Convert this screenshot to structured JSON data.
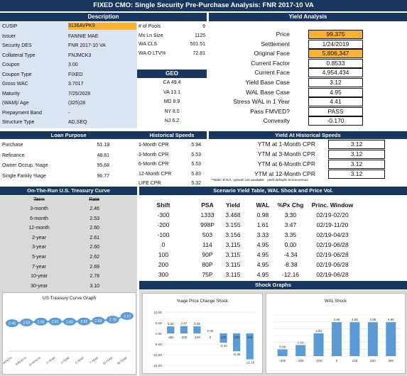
{
  "title": "FIXED CMO: Single Security Pre-Purchase Analysis: FNR 2017-10 VA",
  "description": {
    "header": "Description",
    "left": [
      {
        "label": "CUSIP",
        "value": "3136AVPK9",
        "highlight": true
      },
      {
        "label": "Issuer",
        "value": "FANNIE MAE"
      },
      {
        "label": "Security DES",
        "value": "FNR 2017-10 VA"
      },
      {
        "label": "Collateral Type",
        "value": "FNJMCK3"
      },
      {
        "label": "Coupon",
        "value": "3.00"
      },
      {
        "label": "Coupon Type",
        "value": "FIXED"
      },
      {
        "label": "Gross WAC",
        "value": "3.7017"
      },
      {
        "label": "Maturity",
        "value": "7/25/2028"
      },
      {
        "label": "(WAM)/ Age",
        "value": "(325)28"
      },
      {
        "label": "Prepayment Band",
        "value": "-"
      },
      {
        "label": "Structure Type",
        "value": "AD,SEQ"
      }
    ],
    "right": [
      {
        "label": "# of Pools",
        "value": "9"
      },
      {
        "label": "Mx Ln Size",
        "value": "1125"
      },
      {
        "label": "WA CLS",
        "value": "501.51"
      },
      {
        "label": "WA O LTV%",
        "value": "72.81"
      }
    ]
  },
  "geo": {
    "header": "GEO",
    "items": [
      "CA 49.4",
      "VA 13.1",
      "MD 8.9",
      "NY 8.0",
      "NJ 6.2"
    ]
  },
  "yield_analysis": {
    "header": "Yield Analysis",
    "rows": [
      {
        "label": "Price",
        "value": "99.375",
        "highlight": true
      },
      {
        "label": "Settlement",
        "value": "1/24/2019"
      },
      {
        "label": "Original Face",
        "value": "5,806,347",
        "highlight": true
      },
      {
        "label": "Current Factor",
        "value": "0.8533"
      },
      {
        "label": "Current Face",
        "value": "4,954,434"
      },
      {
        "label": "Yield Base Case",
        "value": "3.12"
      },
      {
        "label": "WAL Base Case",
        "value": "4.95"
      },
      {
        "label": "Stress WAL in 1 Year",
        "value": "4.41"
      },
      {
        "label": "Pass FMVED?",
        "value": "PASS"
      },
      {
        "label": "Convexity",
        "value": "-0.170"
      }
    ]
  },
  "loan_purpose": {
    "header": "Loan Purpose",
    "rows": [
      {
        "label": "Purchase",
        "value": "51.19"
      },
      {
        "label": "Refinance",
        "value": "48.81"
      },
      {
        "label": "Owner Occup. %age",
        "value": "95.68"
      },
      {
        "label": "Single Family %age",
        "value": "96.77"
      }
    ]
  },
  "historical_speeds": {
    "header": "Historical Speeds",
    "rows": [
      {
        "label": "1-Month CPR",
        "value": "5.94"
      },
      {
        "label": "3-Month CPR",
        "value": "5.53"
      },
      {
        "label": "6-Month CPR",
        "value": "5.53"
      },
      {
        "label": "12-Month CPR",
        "value": "5.83"
      },
      {
        "label": "LIFE CPR",
        "value": "5.32"
      }
    ]
  },
  "yield_hist": {
    "header": "Yield At Historical Speeds",
    "rows": [
      {
        "label": "YTM at 1-Month CPR",
        "value": "3.12"
      },
      {
        "label": "YTM at 3-Month CPR",
        "value": "3.12"
      },
      {
        "label": "YTM at 6-Month CPR",
        "value": "3.12"
      },
      {
        "label": "YTM at 12-Month CPR",
        "value": "3.12"
      }
    ],
    "note": "**Note: If N/A: speeds not available - yield defaults to consensus"
  },
  "treasury": {
    "header": "On-The-Run U.S. Treasury Curve",
    "col_term": "Term",
    "col_rate": "Rate",
    "rows": [
      {
        "term": "3-month",
        "rate": "2.46"
      },
      {
        "term": "6-month",
        "rate": "2.53"
      },
      {
        "term": "12-month",
        "rate": "2.60"
      },
      {
        "term": "2-year",
        "rate": "2.61"
      },
      {
        "term": "3-year",
        "rate": "2.60"
      },
      {
        "term": "5-year",
        "rate": "2.62"
      },
      {
        "term": "7-year",
        "rate": "2.69"
      },
      {
        "term": "10-year",
        "rate": "2.78"
      },
      {
        "term": "30-year",
        "rate": "3.10"
      }
    ]
  },
  "scenario": {
    "header": "Scenario Yield Table, WAL Shock and Price Vol.",
    "columns": [
      "Shift",
      "PSA",
      "Yield",
      "WAL",
      "%Px Chg",
      "Princ. Window"
    ],
    "rows": [
      [
        "-300",
        "1333",
        "3.468",
        "0.98",
        "3.30",
        "02/19-02/20"
      ],
      [
        "-200",
        "998P",
        "3.155",
        "1.61",
        "3.47",
        "02/19-11/20"
      ],
      [
        "-100",
        "503",
        "3.156",
        "3.33",
        "3.35",
        "02/19-04/23"
      ],
      [
        "0",
        "114",
        "3.115",
        "4.95",
        "0.00",
        "02/19-06/28"
      ],
      [
        "100",
        "90P",
        "3.115",
        "4.95",
        "-4.34",
        "02/19-06/28"
      ],
      [
        "200",
        "80P",
        "3.115",
        "4.95",
        "-8.38",
        "02/19-06/28"
      ],
      [
        "300",
        "75P",
        "3.115",
        "4.95",
        "-12.16",
        "02/19-06/28"
      ]
    ]
  },
  "shock_graphs": {
    "header": "Shock Graphs"
  },
  "chart_data": [
    {
      "type": "line",
      "title": "US Treasury Curve Graph",
      "categories": [
        "3-MONTH",
        "6-MONTH",
        "12-MONTH",
        "2-YEAR",
        "3-YEAR",
        "5-YEAR",
        "7-YEAR",
        "10-YEAR",
        "30-YEAR"
      ],
      "values": [
        2.46,
        2.53,
        2.6,
        2.61,
        2.6,
        2.62,
        2.69,
        2.78,
        3.1
      ],
      "ylim": [
        0,
        4
      ],
      "grid": false,
      "color": "#5b9bd5"
    },
    {
      "type": "bar",
      "title": "%age Price Change Shock",
      "categories": [
        "-300",
        "-200",
        "-100",
        "0",
        "100",
        "200",
        "300"
      ],
      "values": [
        3.3,
        3.47,
        3.35,
        0,
        -4.34,
        -8.38,
        -12.16
      ],
      "ylim": [
        -15,
        10
      ],
      "yticks": [
        "10.00",
        "5.00",
        "0.00",
        "-5.00",
        "-10.00",
        "-15.00"
      ],
      "grid": true,
      "color": "#5b9bd5"
    },
    {
      "type": "bar",
      "title": "WAL Shock",
      "categories": [
        "-300",
        "-200",
        "-100",
        "0",
        "100",
        "200",
        "300"
      ],
      "values": [
        0.98,
        1.61,
        3.33,
        4.95,
        4.95,
        4.95,
        4.95
      ],
      "ylim": [
        0,
        6
      ],
      "grid": true,
      "color": "#5b9bd5"
    }
  ]
}
